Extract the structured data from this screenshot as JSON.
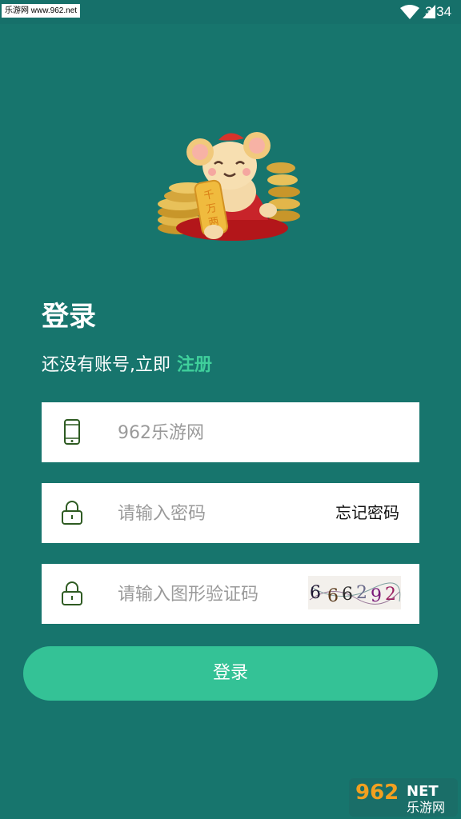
{
  "status_bar": {
    "source_label": "乐游网 www.962.net",
    "time": "3:34",
    "icons": [
      "wifi-icon",
      "battery-icon"
    ]
  },
  "mascot": {
    "plaque_text": "千万两"
  },
  "login": {
    "title": "登录",
    "register_prompt": "还没有账号,立即",
    "register_link": "注册"
  },
  "form": {
    "phone": {
      "placeholder": "962乐游网",
      "value": "",
      "icon": "phone-icon"
    },
    "password": {
      "placeholder": "请输入密码",
      "value": "",
      "icon": "lock-icon",
      "forgot_label": "忘记密码"
    },
    "captcha": {
      "placeholder": "请输入图形验证码",
      "value": "",
      "icon": "lock-icon",
      "image_text": "6 6 6 2 9 2"
    },
    "submit_label": "登录"
  },
  "watermark": {
    "top": "962NET",
    "bottom": "乐游网"
  },
  "colors": {
    "background": "#17756d",
    "accent": "#34c296",
    "link": "#3fcf9b",
    "icon": "#2e5b22"
  }
}
